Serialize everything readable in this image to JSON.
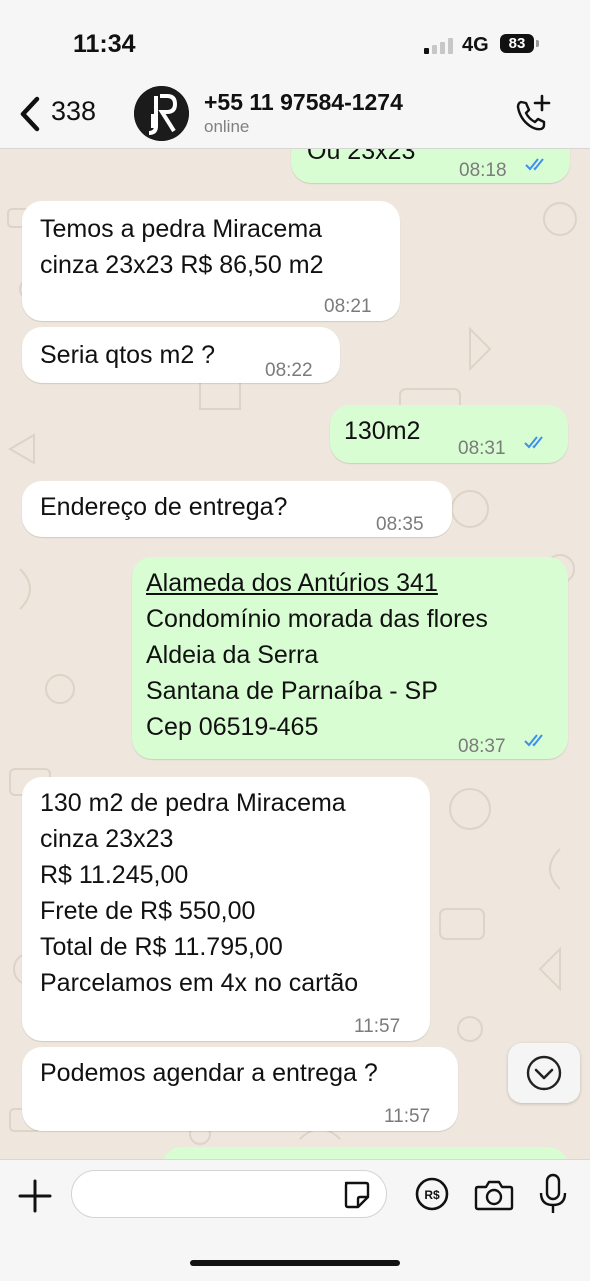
{
  "status_bar": {
    "time": "11:34",
    "network": "4G",
    "battery": "83"
  },
  "header": {
    "unread_count": "338",
    "contact_name": "+55 11 97584-1274",
    "contact_status": "online"
  },
  "messages": [
    {
      "direction": "outgoing",
      "lines": [
        "Ou 23x23"
      ],
      "time": "08:18",
      "read": true
    },
    {
      "direction": "incoming",
      "lines": [
        "Temos a pedra Miracema",
        "cinza 23x23 R$ 86,50 m2"
      ],
      "time": "08:21"
    },
    {
      "direction": "incoming",
      "lines": [
        "Seria qtos m2 ?"
      ],
      "time": "08:22"
    },
    {
      "direction": "outgoing",
      "lines": [
        "130m2"
      ],
      "time": "08:31",
      "read": true
    },
    {
      "direction": "incoming",
      "lines": [
        "Endereço de entrega?"
      ],
      "time": "08:35"
    },
    {
      "direction": "outgoing",
      "lines": [
        "Alameda dos Antúrios 341",
        "Condomínio morada das flores",
        "Aldeia da Serra",
        "Santana de Parnaíba - SP",
        "Cep 06519-465"
      ],
      "time": "08:37",
      "read": true
    },
    {
      "direction": "incoming",
      "lines": [
        "130 m2 de pedra Miracema",
        "cinza 23x23",
        "R$ 11.245,00",
        "Frete de R$ 550,00",
        "Total de R$ 11.795,00",
        "Parcelamos em 4x no cartão"
      ],
      "time": "11:57"
    },
    {
      "direction": "incoming",
      "lines": [
        "Podemos agendar a entrega ?"
      ],
      "time": "11:57"
    }
  ],
  "composer": {
    "input_value": ""
  },
  "colors": {
    "outgoing_bubble": "#d9fdd3",
    "incoming_bubble": "#ffffff",
    "read_ticks": "#3d8ff0",
    "chat_background": "#efe7dd"
  },
  "icons": [
    "back-chevron-icon",
    "avatar-logo",
    "add-call-icon",
    "read-ticks-icon",
    "scroll-down-icon",
    "plus-icon",
    "sticker-icon",
    "payment-icon",
    "camera-icon",
    "microphone-icon"
  ]
}
